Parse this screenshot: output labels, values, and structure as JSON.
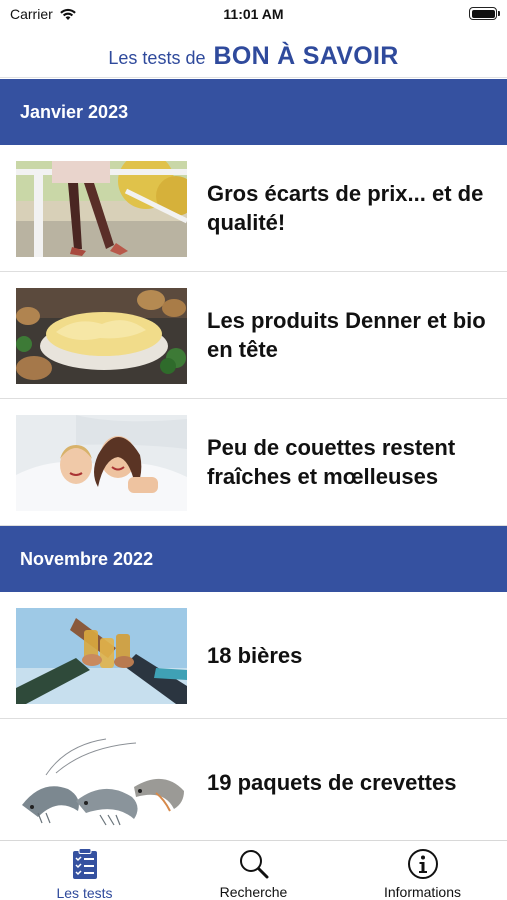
{
  "status_bar": {
    "carrier": "Carrier",
    "time": "11:01 AM"
  },
  "header": {
    "prefix": "Les tests de",
    "brand": "BON À SAVOIR"
  },
  "sections": [
    {
      "label": "Janvier 2023",
      "articles": [
        {
          "title": "Gros écarts de prix... et de qualité!",
          "image": "collants-photo"
        },
        {
          "title": "Les produits Denner et bio en tête",
          "image": "puree-photo"
        },
        {
          "title": "Peu de couettes restent fraîches et mœlleuses",
          "image": "couette-photo"
        }
      ]
    },
    {
      "label": "Novembre 2022",
      "articles": [
        {
          "title": "18 bières",
          "image": "bieres-photo"
        },
        {
          "title": "19 paquets de crevettes",
          "image": "crevettes-photo"
        }
      ]
    }
  ],
  "tab_bar": {
    "tabs": [
      {
        "label": "Les tests",
        "icon": "clipboard-checklist-icon",
        "active": true
      },
      {
        "label": "Recherche",
        "icon": "magnifier-icon",
        "active": false
      },
      {
        "label": "Informations",
        "icon": "info-circle-icon",
        "active": false
      }
    ]
  },
  "colors": {
    "accent": "#3551a0",
    "brand_text": "#2f4a9c",
    "background": "#ffffff"
  }
}
